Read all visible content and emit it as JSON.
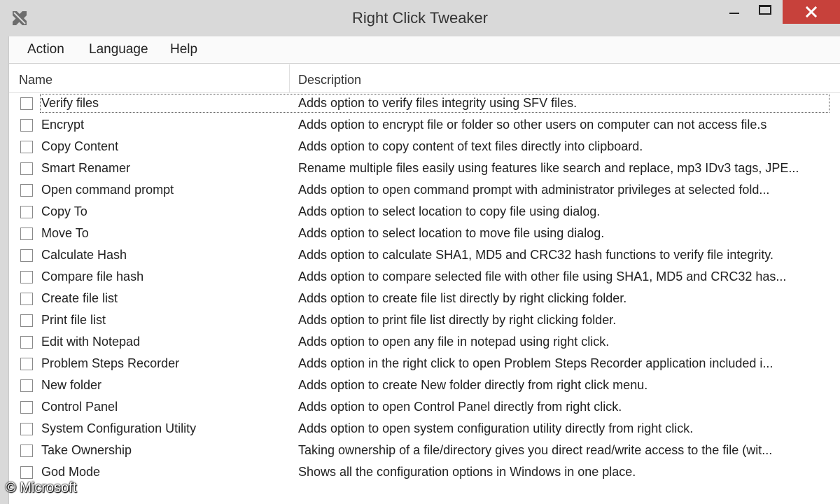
{
  "window": {
    "title": "Right Click Tweaker"
  },
  "menu": {
    "action": "Action",
    "language": "Language",
    "help": "Help"
  },
  "list": {
    "columns": {
      "name": "Name",
      "description": "Description"
    },
    "rows": [
      {
        "name": "Verify files",
        "description": "Adds option to verify files integrity using SFV files.",
        "checked": false
      },
      {
        "name": "Encrypt",
        "description": "Adds option to encrypt file or folder so other users on computer can not access file.s",
        "checked": false
      },
      {
        "name": "Copy Content",
        "description": "Adds option to copy content of text files directly into clipboard.",
        "checked": false
      },
      {
        "name": "Smart Renamer",
        "description": "Rename multiple files easily using features like search and replace, mp3 IDv3 tags, JPE...",
        "checked": false
      },
      {
        "name": "Open command prompt",
        "description": "Adds option to open command prompt with administrator privileges at selected fold...",
        "checked": false
      },
      {
        "name": "Copy To",
        "description": "Adds option to select location to copy file using dialog.",
        "checked": false
      },
      {
        "name": "Move To",
        "description": "Adds option to select location to move file using dialog.",
        "checked": false
      },
      {
        "name": "Calculate Hash",
        "description": "Adds option to calculate SHA1, MD5 and CRC32 hash functions to verify file integrity.",
        "checked": false
      },
      {
        "name": "Compare file hash",
        "description": "Adds option to compare selected file with other file using SHA1, MD5 and CRC32 has...",
        "checked": false
      },
      {
        "name": "Create file list",
        "description": "Adds option to create file list directly by right clicking folder.",
        "checked": false
      },
      {
        "name": "Print file list",
        "description": "Adds option to print file list directly by right clicking folder.",
        "checked": false
      },
      {
        "name": "Edit with Notepad",
        "description": "Adds option to open any file in notepad using right click.",
        "checked": false
      },
      {
        "name": "Problem Steps Recorder",
        "description": "Adds option in the right click to open Problem Steps Recorder application included i...",
        "checked": false
      },
      {
        "name": "New folder",
        "description": "Adds option to create New folder directly from right click menu.",
        "checked": false
      },
      {
        "name": "Control Panel",
        "description": "Adds option to open Control Panel directly from right click.",
        "checked": false
      },
      {
        "name": "System Configuration Utility",
        "description": "Adds option to open system configuration utility directly from right click.",
        "checked": false
      },
      {
        "name": "Take Ownership",
        "description": "Taking ownership of a file/directory gives you direct read/write access to the file (wit...",
        "checked": false
      },
      {
        "name": "God Mode",
        "description": "Shows all the configuration options in Windows in one place.",
        "checked": false
      }
    ]
  },
  "watermark": "© Microsoft",
  "icons": {
    "app": "tools-icon",
    "minimize": "minimize-icon",
    "maximize": "maximize-icon",
    "close": "close-icon"
  },
  "colors": {
    "titlebar": "#d9d9d9",
    "close_button": "#c7413b",
    "background": "#ffffff"
  }
}
